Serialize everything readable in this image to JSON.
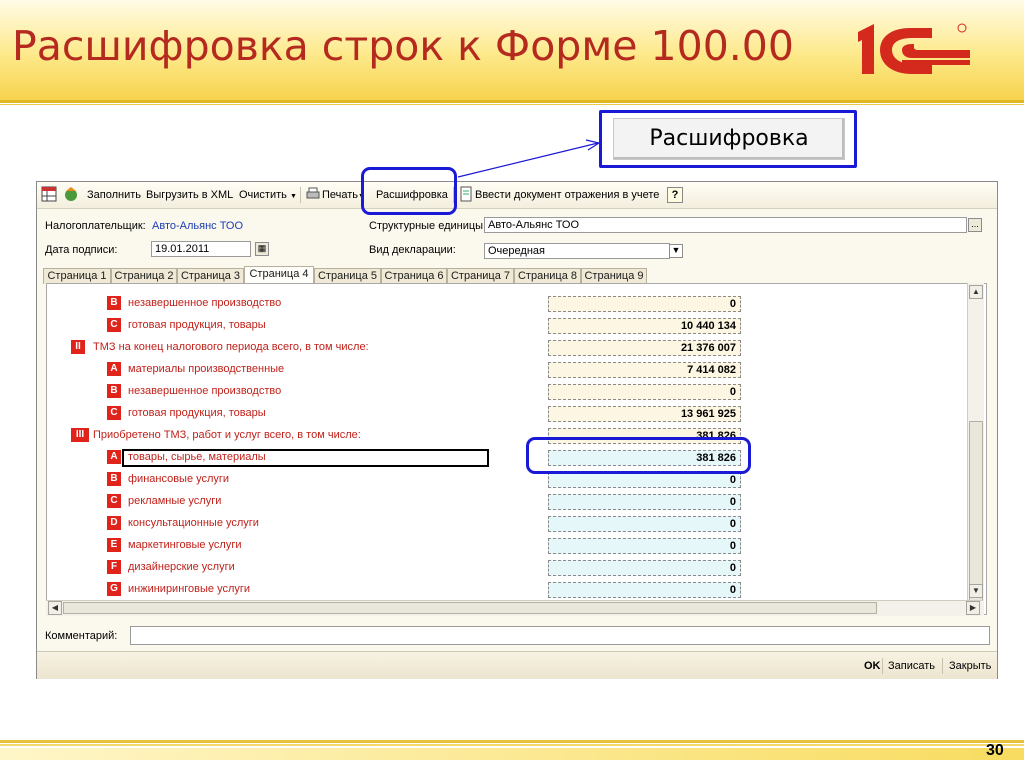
{
  "slide": {
    "title": "Расшифровка строк к Форме 100.00",
    "callout_label": "Расшифровка",
    "page_number": "30",
    "colors": {
      "title": "#b52a1f",
      "highlight": "#1a1ad6",
      "badge": "#e0231b"
    }
  },
  "toolbar": {
    "fill_label": "Заполнить",
    "export_xml_label": "Выгрузить в XML",
    "clear_label": "Очистить",
    "print_label": "Печать",
    "decode_label": "Расшифровка",
    "enter_doc_label": "Ввести документ отражения в учете",
    "help_label": "?"
  },
  "form": {
    "taxpayer_label": "Налогоплательщик:",
    "taxpayer_value": "Авто-Альянс ТОО",
    "units_label": "Структурные единицы:",
    "units_value": "Авто-Альянс ТОО",
    "units_button": "...",
    "sign_date_label": "Дата подписи:",
    "sign_date_value": "19.01.2011",
    "decl_type_label": "Вид декларации:",
    "decl_type_value": "Очередная",
    "comment_label": "Комментарий:",
    "comment_value": ""
  },
  "tabs": [
    "Страница 1",
    "Страница 2",
    "Страница 3",
    "Страница 4",
    "Страница 5",
    "Страница 6",
    "Страница 7",
    "Страница 8",
    "Страница 9"
  ],
  "active_tab": "Страница 4",
  "rows": [
    {
      "badge": "B",
      "label": "незавершенное производство",
      "value": "0",
      "cell": "yellow"
    },
    {
      "badge": "C",
      "label": "готовая продукция, товары",
      "value": "10 440 134",
      "cell": "yellow"
    },
    {
      "badge": "II",
      "label": "ТМЗ на конец налогового периода всего, в том числе:",
      "value": "21 376 007",
      "cell": "yellow"
    },
    {
      "badge": "A",
      "label": "материалы производственные",
      "value": "7 414 082",
      "cell": "yellow"
    },
    {
      "badge": "B",
      "label": "незавершенное производство",
      "value": "0",
      "cell": "yellow"
    },
    {
      "badge": "C",
      "label": "готовая продукция, товары",
      "value": "13 961 925",
      "cell": "yellow"
    },
    {
      "badge": "III",
      "label": "Приобретено ТМЗ, работ и услуг всего, в том числе:",
      "value": "381 826",
      "cell": "yellow"
    },
    {
      "badge": "A",
      "label": "товары, сырье, материалы",
      "value": "381 826",
      "cell": "blue"
    },
    {
      "badge": "B",
      "label": "финансовые услуги",
      "value": "0",
      "cell": "blue"
    },
    {
      "badge": "C",
      "label": "рекламные услуги",
      "value": "0",
      "cell": "blue"
    },
    {
      "badge": "D",
      "label": "консультационные услуги",
      "value": "0",
      "cell": "blue"
    },
    {
      "badge": "E",
      "label": "маркетинговые услуги",
      "value": "0",
      "cell": "blue"
    },
    {
      "badge": "F",
      "label": "дизайнерские услуги",
      "value": "0",
      "cell": "blue"
    },
    {
      "badge": "G",
      "label": "инжиниринговые услуги",
      "value": "0",
      "cell": "blue"
    }
  ],
  "status": {
    "ok_label": "OK",
    "save_label": "Записать",
    "close_label": "Закрыть"
  }
}
